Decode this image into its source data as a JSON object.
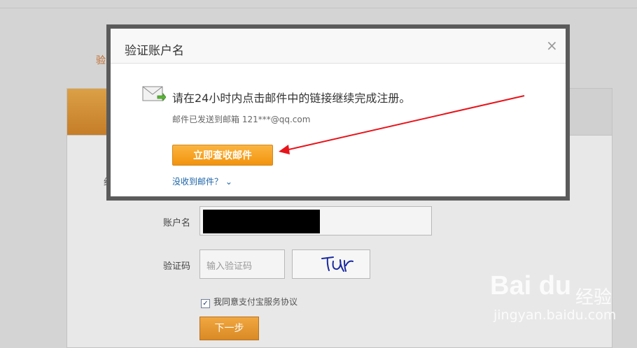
{
  "background": {
    "step_label_fragment": "验",
    "card_label_fragment": "绍",
    "account_label": "账户名",
    "captcha_label": "验证码",
    "captcha_placeholder": "输入验证码",
    "captcha_image_text": "TJUr",
    "agree_prefix": "我同意",
    "agree_link": "支付宝服务协议",
    "next_button": "下一步",
    "accent_color": "#d98a25"
  },
  "modal": {
    "title": "验证账户名",
    "close_symbol": "×",
    "instruction": "请在24小时内点击邮件中的链接继续完成注册。",
    "sent_to": "邮件已发送到邮箱 121***@qq.com",
    "check_mail_button": "立即查收邮件",
    "no_mail_link": "没收到邮件？",
    "icon": "envelope-icon",
    "button_color": "#f2930d"
  },
  "annotation": {
    "color": "#e8141b",
    "shape": "arrow"
  },
  "watermark": {
    "logo": "Bai du",
    "label": "经验",
    "url": "jingyan.baidu.com"
  }
}
